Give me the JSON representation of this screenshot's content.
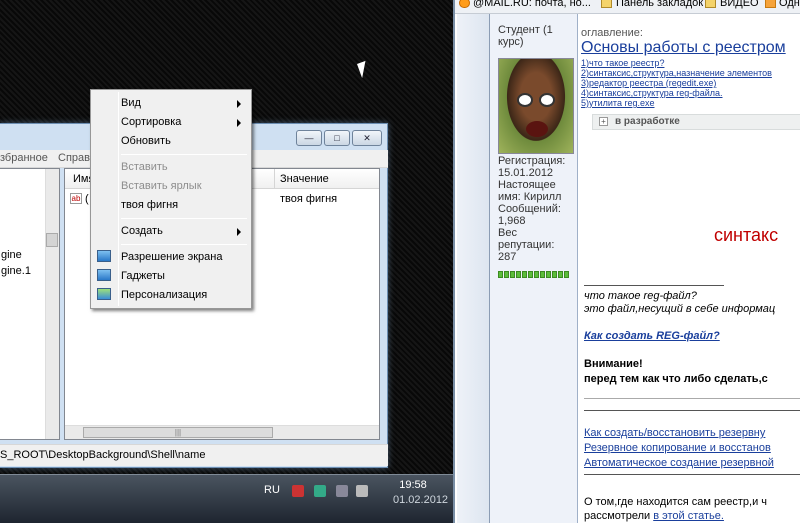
{
  "regedit": {
    "menu": {
      "favorites": "збранное",
      "help": "Справ"
    },
    "tree_nodes": [
      "gine",
      "gine.1"
    ],
    "columns": {
      "name": "Имя",
      "value": "Значение"
    },
    "row": {
      "name": "(",
      "value": "твоя фигня"
    },
    "statusbar": "S_ROOT\\DesktopBackground\\Shell\\name",
    "window_buttons": [
      "—",
      "□",
      "✕"
    ]
  },
  "context_menu": {
    "items": [
      {
        "label": "Вид",
        "submenu": true,
        "disabled": false
      },
      {
        "label": "Сортировка",
        "submenu": true,
        "disabled": false
      },
      {
        "label": "Обновить",
        "submenu": false,
        "disabled": false
      },
      {
        "label": "Вставить",
        "submenu": false,
        "disabled": true
      },
      {
        "label": "Вставить ярлык",
        "submenu": false,
        "disabled": true
      },
      {
        "label": "твоя фигня",
        "submenu": false,
        "disabled": false
      },
      {
        "label": "Создать",
        "submenu": true,
        "disabled": false
      },
      {
        "label": "Разрешение экрана",
        "submenu": false,
        "disabled": false,
        "icon": "display-icon"
      },
      {
        "label": "Гаджеты",
        "submenu": false,
        "disabled": false,
        "icon": "gadgets-icon"
      },
      {
        "label": "Персонализация",
        "submenu": false,
        "disabled": false,
        "icon": "personalize-icon"
      }
    ]
  },
  "taskbar": {
    "lang": "RU",
    "time": "19:58",
    "date": "01.02.2012"
  },
  "browser": {
    "bookmarks": [
      {
        "label": "@MAIL.RU: почта, но...",
        "icon": "mailru-icon"
      },
      {
        "label": "Панель закладок",
        "icon": "folder-icon"
      },
      {
        "label": "ВИДЕО",
        "icon": "folder-icon"
      },
      {
        "label": "Одн",
        "icon": "odnoklassniki-icon"
      }
    ],
    "profile": {
      "rank": [
        "Студент (1",
        "курс)"
      ],
      "info": [
        "Регистрация:",
        "15.01.2012",
        "Настоящее",
        "имя: Кирилл",
        "Сообщений:",
        "1,968",
        "Вес",
        "репутации:",
        "287"
      ]
    },
    "content": {
      "toc_label": "оглавление:",
      "title": "Основы работы с реестром",
      "toc": [
        "1)что такое реестр?",
        "2)синтаксис,структура,назначение элементов",
        "3)редактор реестра (regedit.exe)",
        "4)синтаксис,структура reg-файла.",
        "5)утилита reg.exe"
      ],
      "dev_label": "в разработке",
      "heading": "синтакс",
      "reg_q": "что такое reg-файл?",
      "reg_a": "это файл,несущий в себе информац",
      "create_link": "Как создать REG-файл?",
      "warning": "Внимание!",
      "warning_text": "перед тем как что либо сделать,с",
      "backup_links": [
        "Как создать/восстановить резервну",
        "Резервное копирование и восстанов",
        "Автоматическое создание резервной"
      ],
      "bottom1": "О том,где находится сам реестр,и ч",
      "bottom2_prefix": "рассмотрели ",
      "bottom2_link": "в этой статье."
    }
  }
}
